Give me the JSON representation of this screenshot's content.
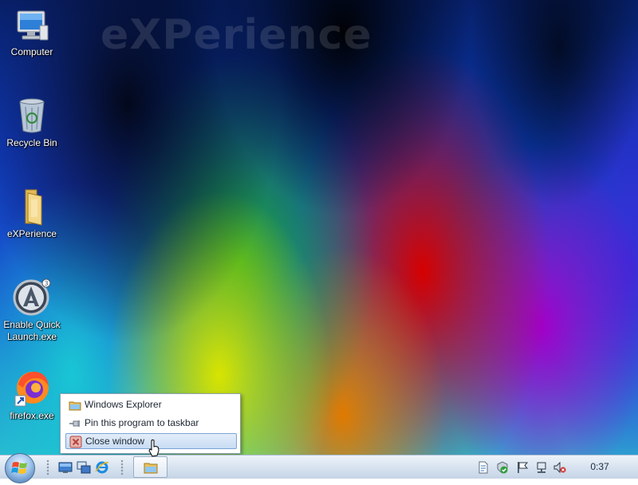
{
  "desktop": {
    "watermark": "eXPerience",
    "icons": [
      {
        "label": "Computer",
        "icon": "computer-icon"
      },
      {
        "label": "Recycle Bin",
        "icon": "recycle-bin-icon"
      },
      {
        "label": "eXPerience",
        "icon": "folder-icon"
      },
      {
        "label_line1": "Enable Quick",
        "label_line2": "Launch.exe",
        "icon": "aimp-icon"
      },
      {
        "label": "firefox.exe",
        "icon": "firefox-icon"
      }
    ]
  },
  "jumplist": {
    "items": [
      {
        "label": "Windows Explorer",
        "icon": "explorer-folder-icon"
      },
      {
        "label": "Pin this program to taskbar",
        "icon": "pin-icon"
      },
      {
        "label": "Close window",
        "icon": "close-window-icon",
        "highlighted": true
      }
    ]
  },
  "taskbar": {
    "start_icon": "windows-orb-icon",
    "quick_launch": [
      "show-desktop-icon",
      "switch-windows-icon",
      "internet-explorer-icon"
    ],
    "task_buttons": [
      "explorer-folder-icon"
    ],
    "tray_icons": [
      "document-icon",
      "security-check-icon",
      "action-center-flag-icon",
      "network-icon",
      "volume-muted-icon"
    ],
    "clock": "0:37"
  }
}
